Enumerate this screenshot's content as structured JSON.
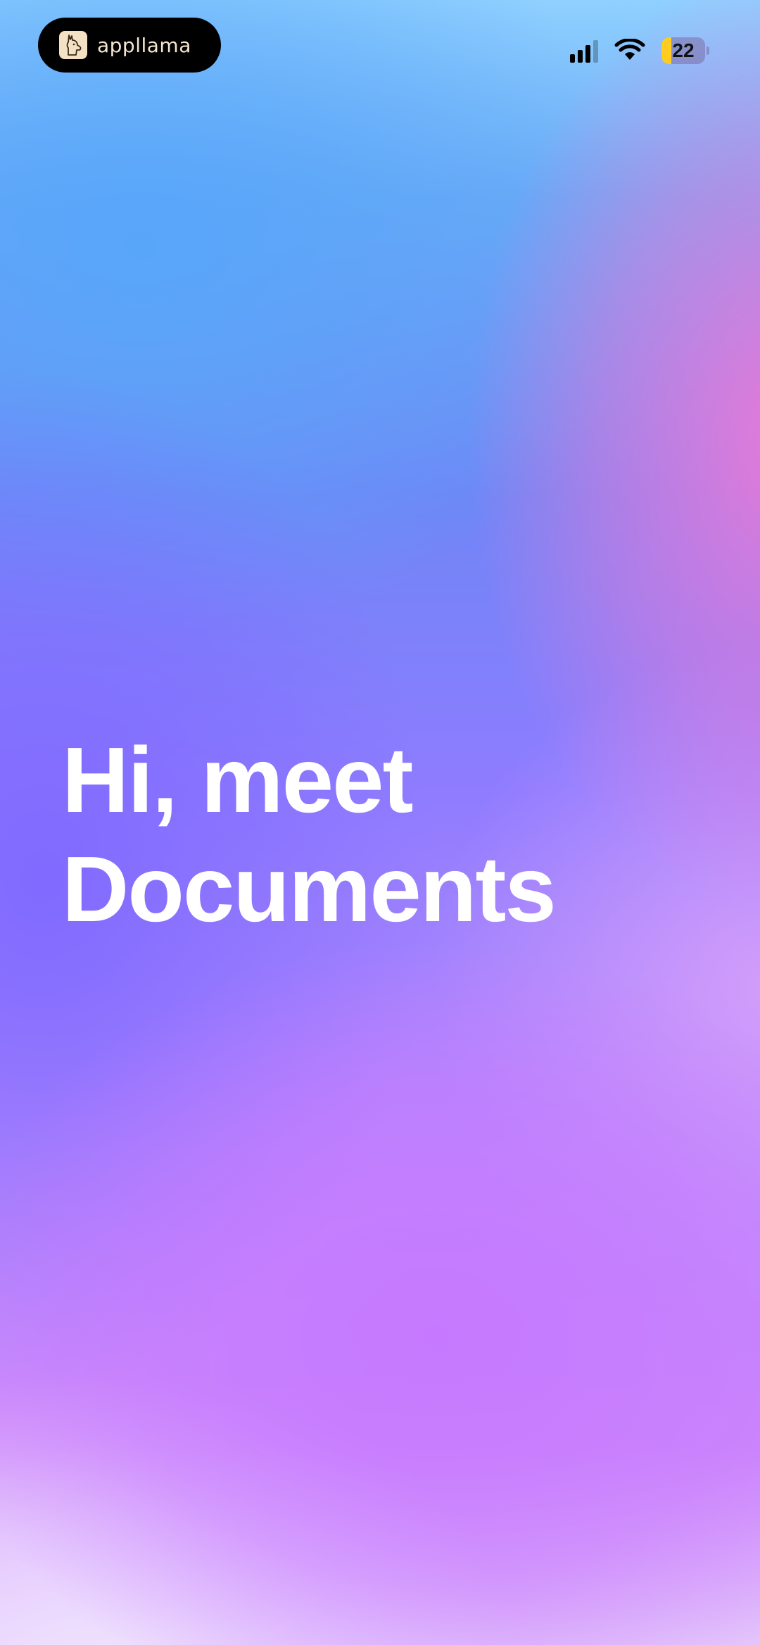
{
  "status_bar": {
    "app_name": "appllama",
    "battery_level": "22",
    "battery_fraction": 0.22,
    "signal_bars_active": 3,
    "signal_bars_total": 4,
    "battery_color": "#ffcc1f",
    "icons": [
      "llama-logo-icon",
      "signal-icon",
      "wifi-icon",
      "battery-icon"
    ]
  },
  "main": {
    "headline_line1": "Hi, meet",
    "headline_line2": "Documents"
  },
  "colors": {
    "headline": "#ffffff",
    "gradient_top": "#8fd0ff",
    "gradient_mid": "#8f7cff",
    "gradient_pink": "#ee78d6",
    "gradient_bottom": "#e4c6fb"
  }
}
